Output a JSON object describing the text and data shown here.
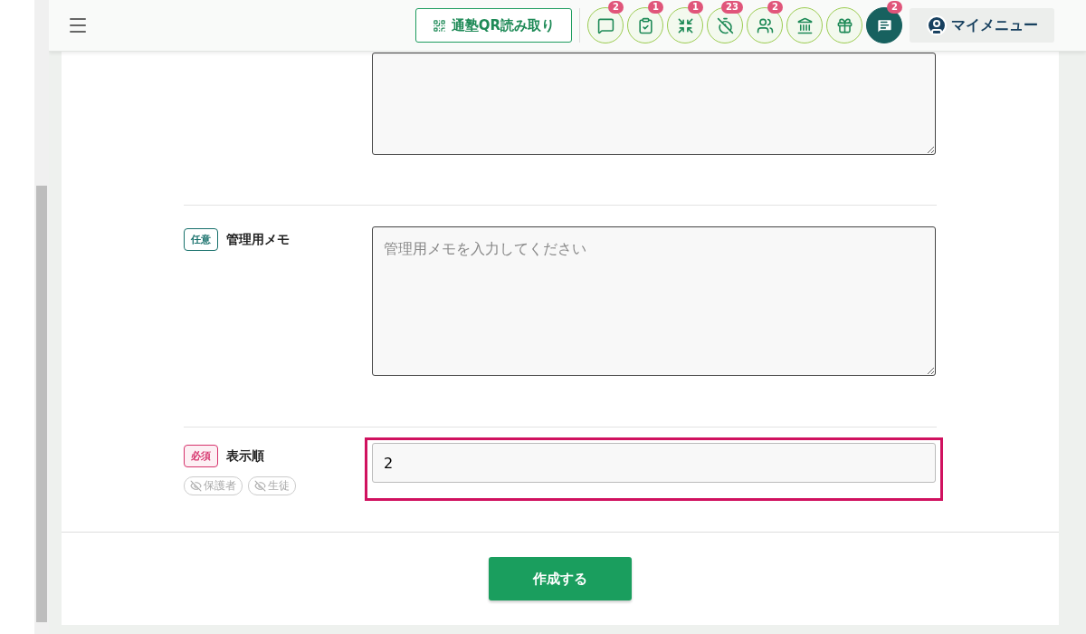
{
  "header": {
    "qr_button": "通塾QR読み取り",
    "icon_buttons": [
      {
        "kind": "message",
        "badge": "2",
        "active": false
      },
      {
        "kind": "checklist",
        "badge": "1",
        "active": false
      },
      {
        "kind": "arrows",
        "badge": "1",
        "active": false
      },
      {
        "kind": "timer-off",
        "badge": "23",
        "active": false
      },
      {
        "kind": "group",
        "badge": "2",
        "active": false
      },
      {
        "kind": "bank",
        "active": false
      },
      {
        "kind": "gift",
        "active": false
      },
      {
        "kind": "chat",
        "badge": "2",
        "active": true
      }
    ],
    "my_menu": "マイメニュー"
  },
  "fields": [
    {
      "kind": "textarea"
    },
    {
      "kind": "textarea",
      "tag": {
        "text": "任意",
        "required": false
      },
      "label": "管理用メモ",
      "placeholder": "管理用メモを入力してください"
    },
    {
      "kind": "input",
      "tag": {
        "text": "必須",
        "required": true
      },
      "label": "表示順",
      "value": "2",
      "highlighted": true,
      "visibility": [
        {
          "text": "保護者",
          "visible": false
        },
        {
          "text": "生徒",
          "visible": false
        }
      ]
    }
  ],
  "submit": "作成する"
}
